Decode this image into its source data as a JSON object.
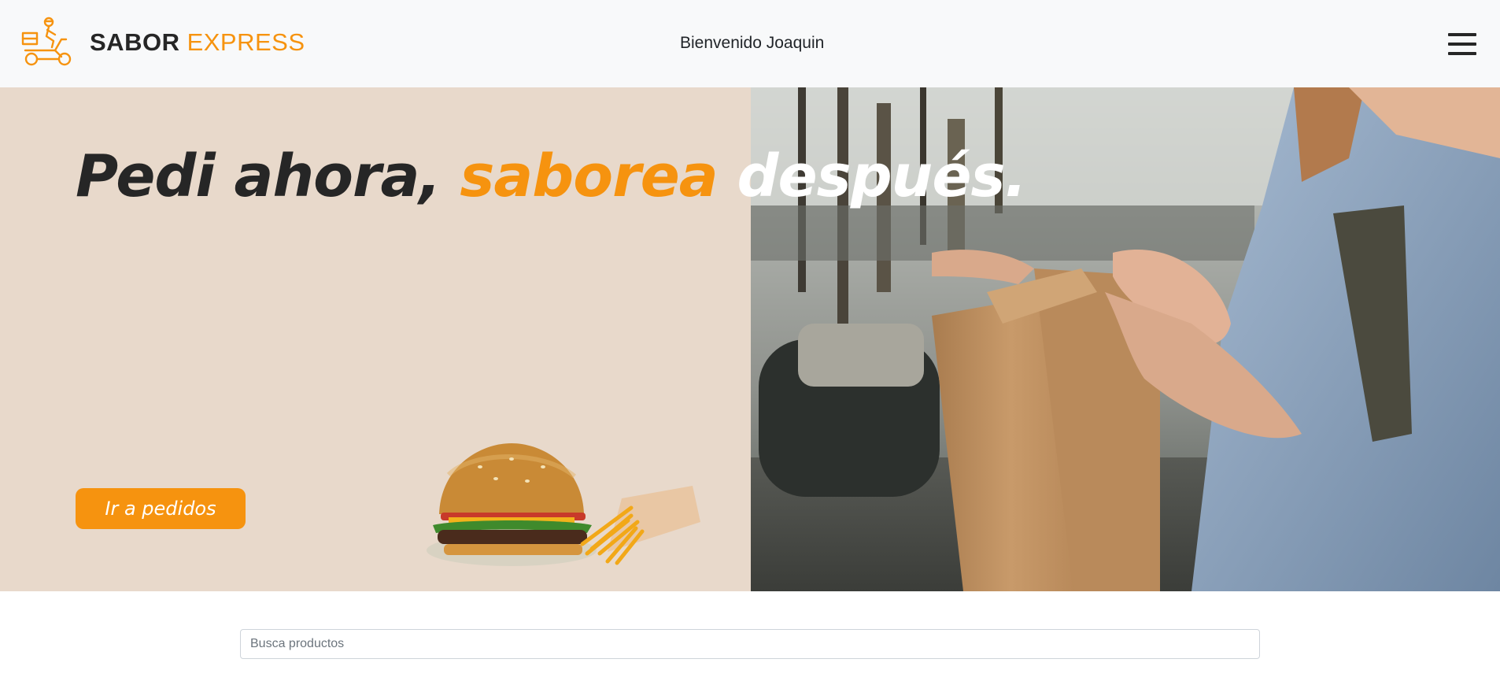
{
  "header": {
    "brand_primary": "SABOR",
    "brand_secondary": "EXPRESS",
    "welcome_text": "Bienvenido Joaquin",
    "logo_icon": "delivery-scooter-icon",
    "menu_icon": "hamburger-menu-icon"
  },
  "hero": {
    "headline_part1": "Pedi ahora,",
    "headline_part2": "saborea",
    "headline_part3": "después.",
    "cta_label": "Ir a pedidos",
    "food_image": "burger-and-fries",
    "photo": "woman-opening-paper-bag"
  },
  "search": {
    "placeholder": "Busca productos",
    "value": ""
  },
  "colors": {
    "accent": "#f6930f",
    "dark": "#262626",
    "hero_bg": "#e8d9cb",
    "navbar_bg": "#f8f9fa"
  }
}
